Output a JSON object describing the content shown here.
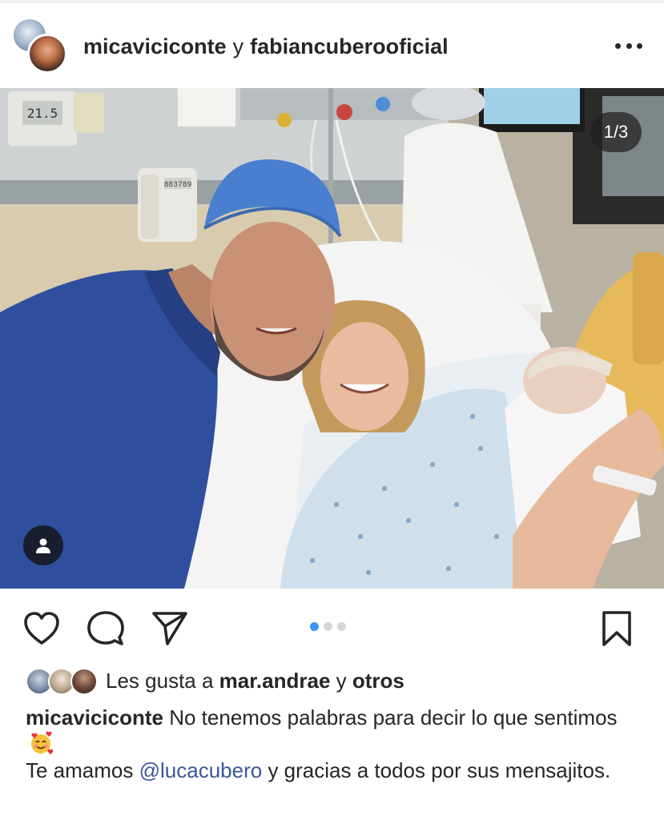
{
  "header": {
    "user1": "micaviciconte",
    "conjunction": "y",
    "user2": "fabiancuberooficial",
    "more_icon": "more-horizontal-icon"
  },
  "photo": {
    "counter": "1/3",
    "tags_icon": "person-icon",
    "thermostat_reading": "21.5",
    "room_phone_label": "883789"
  },
  "actions": {
    "like_icon": "heart-icon",
    "comment_icon": "comment-bubble-icon",
    "share_icon": "paper-plane-icon",
    "save_icon": "bookmark-icon",
    "carousel": {
      "total": 3,
      "active": 1,
      "active_color": "#3897f0"
    }
  },
  "likes": {
    "prefix": "Les gusta a",
    "user": "mar.andrae",
    "conjunction": "y",
    "others": "otros"
  },
  "caption": {
    "user": "micaviciconte",
    "line1": "No tenemos palabras para decir lo que sentimos",
    "emoji": "smiling-face-with-hearts",
    "line2_prefix": "Te amamos",
    "mention": "@lucacubero",
    "line2_suffix": "y gracias  a todos por sus mensajitos."
  },
  "colors": {
    "text": "#262626",
    "mention": "#385898",
    "scrubs": "#2f4f9e",
    "surgical_cap": "#4a7fd0"
  }
}
